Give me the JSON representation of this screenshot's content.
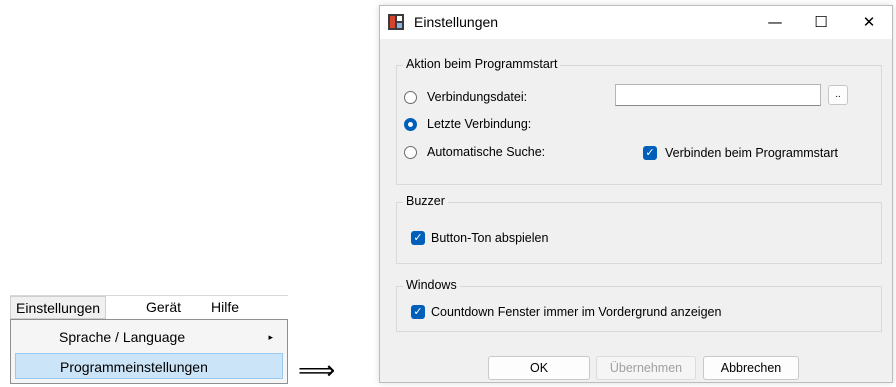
{
  "menubar": {
    "items": [
      {
        "label": "Einstellungen"
      },
      {
        "label": "Gerät"
      },
      {
        "label": "Hilfe"
      }
    ]
  },
  "menu": {
    "items": [
      {
        "label": "Sprache / Language",
        "submenu_arrow": "▸"
      },
      {
        "label": "Programmeinstellungen"
      }
    ]
  },
  "arrow_symbol": "⟹",
  "dialog": {
    "title": "Einstellungen",
    "controls": {
      "minimize": "—",
      "maximize": "☐",
      "close": "✕"
    },
    "startup_group": {
      "label": "Aktion beim Programmstart",
      "options": [
        {
          "label": "Verbindungsdatei:",
          "selected": false
        },
        {
          "label": "Letzte Verbindung:",
          "selected": true
        },
        {
          "label": "Automatische Suche:",
          "selected": false
        }
      ],
      "file_value": "",
      "browse_label": "..",
      "connect_label": "Verbinden beim Programmstart",
      "connect_checked": true
    },
    "buzzer_group": {
      "label": "Buzzer",
      "button_tone_label": "Button-Ton abspielen",
      "button_tone_checked": true
    },
    "windows_group": {
      "label": "Windows",
      "countdown_label": "Countdown Fenster immer im Vordergrund anzeigen",
      "countdown_checked": true
    },
    "buttons": {
      "ok": "OK",
      "apply": "Übernehmen",
      "cancel": "Abbrechen"
    }
  },
  "colors": {
    "accent": "#005fb8",
    "menu_highlight": "#cce4f7"
  }
}
